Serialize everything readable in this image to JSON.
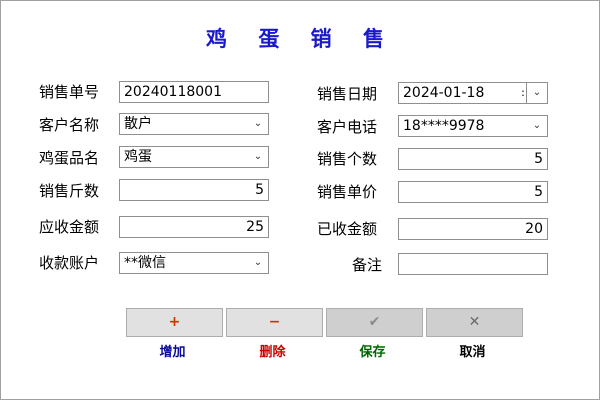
{
  "title": "鸡 蛋 销 售",
  "fields": {
    "order_no": {
      "label": "销售单号",
      "value": "20240118001"
    },
    "customer_name": {
      "label": "客户名称",
      "value": "散户"
    },
    "egg_name": {
      "label": "鸡蛋品名",
      "value": "鸡蛋"
    },
    "weight": {
      "label": "销售斤数",
      "value": "5"
    },
    "receivable": {
      "label": "应收金额",
      "value": "25"
    },
    "account": {
      "label": "收款账户",
      "value": "**微信"
    },
    "sale_date": {
      "label": "销售日期",
      "value": "2024-01-18"
    },
    "customer_phone": {
      "label": "客户电话",
      "value": "18****9978"
    },
    "count": {
      "label": "销售个数",
      "value": "5"
    },
    "unit_price": {
      "label": "销售单价",
      "value": "5"
    },
    "received": {
      "label": "已收金额",
      "value": "20"
    },
    "remark": {
      "label": "备注",
      "value": ""
    }
  },
  "buttons": {
    "add": {
      "icon": "+",
      "label": "增加",
      "color": "#cc3300",
      "label_color": "#0a0a99"
    },
    "delete": {
      "icon": "−",
      "label": "删除",
      "color": "#cc3300",
      "label_color": "#cc0000"
    },
    "save": {
      "icon": "✔",
      "label": "保存",
      "color": "#8a8a8a",
      "label_color": "#006600"
    },
    "cancel": {
      "icon": "✕",
      "label": "取消",
      "color": "#6a6a6a",
      "label_color": "#000000"
    }
  },
  "icons": {
    "dropdown": "chevron-down-icon",
    "date_spin": "date-spinner-icon"
  }
}
